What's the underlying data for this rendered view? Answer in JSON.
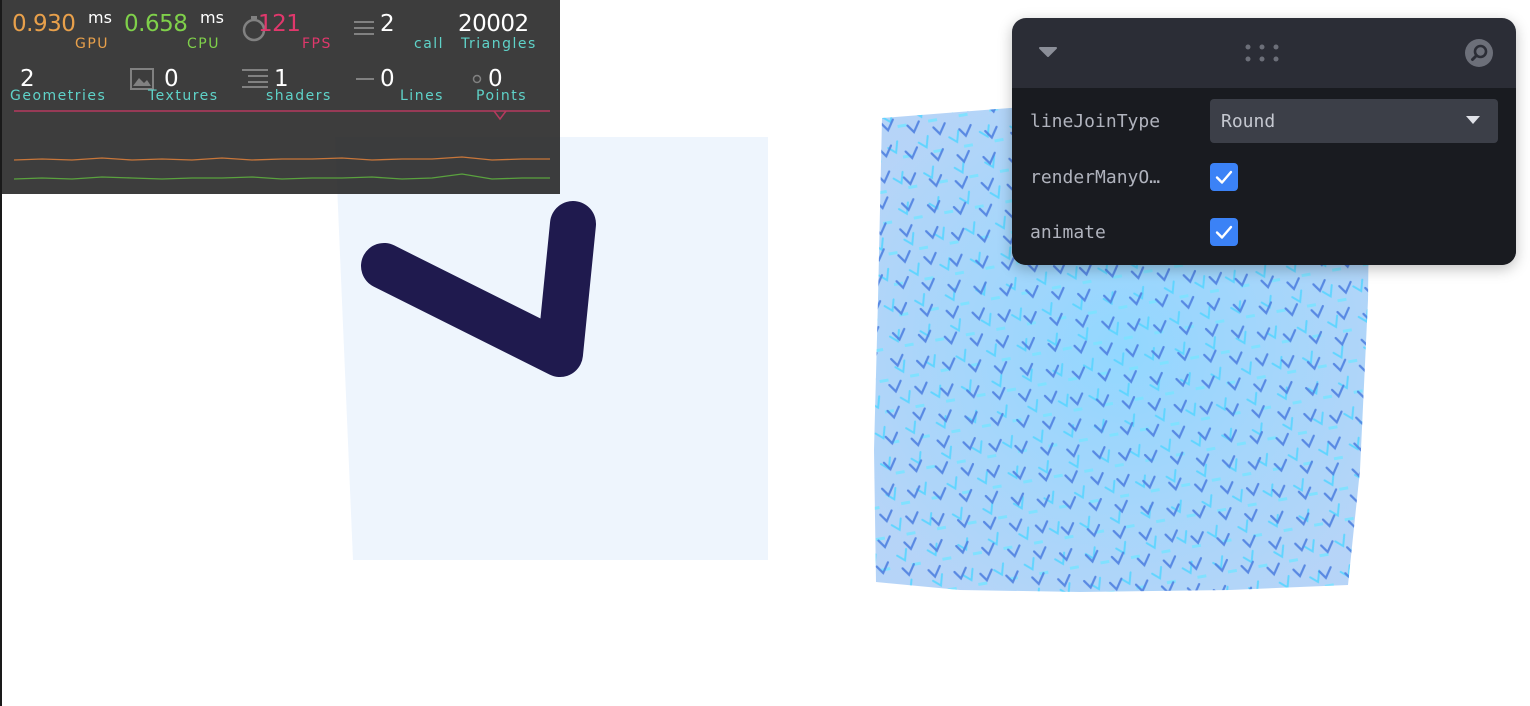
{
  "stats": {
    "gpu": {
      "value": "0.930",
      "unit": "ms",
      "label": "GPU",
      "color": "#e8a04b"
    },
    "cpu": {
      "value": "0.658",
      "unit": "ms",
      "label": "CPU",
      "color": "#7fd04a"
    },
    "fps": {
      "value": "121",
      "label": "FPS",
      "color": "#e0386c"
    },
    "calls": {
      "value": "2",
      "label": "call",
      "color": "#5fd3c9"
    },
    "triangles": {
      "value": "20002",
      "label": "Triangles",
      "color": "#5fd3c9"
    },
    "geometries": {
      "value": "2",
      "label": "Geometries",
      "color": "#5fd3c9"
    },
    "textures": {
      "value": "0",
      "label": "Textures",
      "color": "#5fd3c9"
    },
    "shaders": {
      "value": "1",
      "label": "shaders",
      "color": "#5fd3c9"
    },
    "lines": {
      "value": "0",
      "label": "Lines",
      "color": "#5fd3c9"
    },
    "points": {
      "value": "0",
      "label": "Points",
      "color": "#5fd3c9"
    }
  },
  "gui": {
    "line_join": {
      "label": "lineJoinType",
      "value": "Round"
    },
    "render_many": {
      "label": "renderManyO…",
      "checked": true
    },
    "animate": {
      "label": "animate",
      "checked": true
    }
  },
  "colors": {
    "line_stroke": "#1f1a4e",
    "plane": "#eef5fd",
    "instances": "#4aa3f0",
    "accent": "#3b82f6"
  }
}
